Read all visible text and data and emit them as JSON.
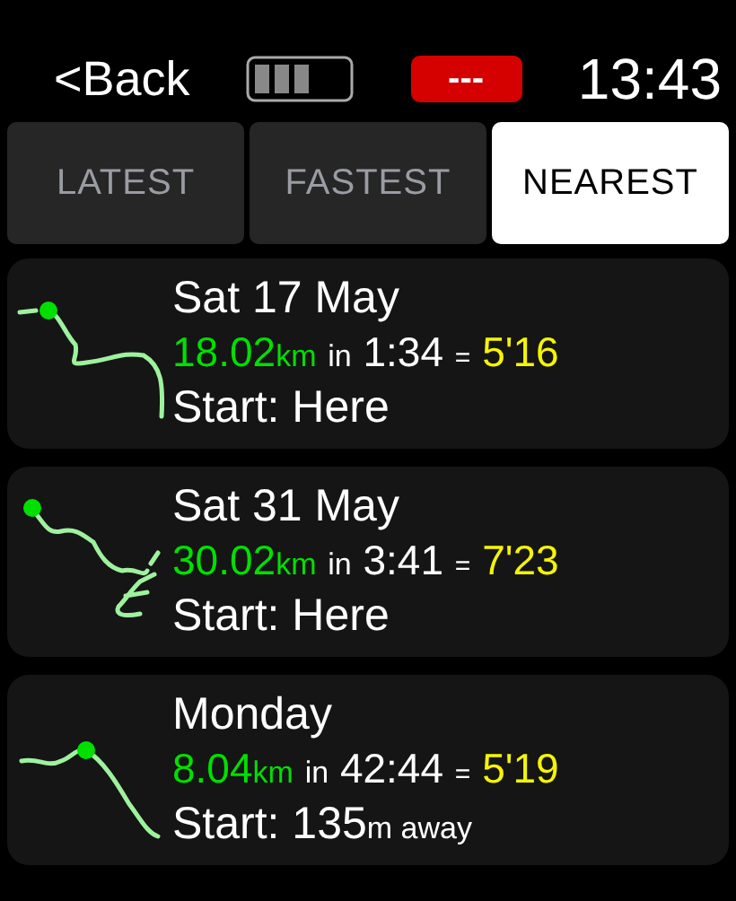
{
  "header": {
    "back": "<Back",
    "badge": "---",
    "time": "13:43"
  },
  "tabs": [
    {
      "label": "LATEST",
      "selected": false
    },
    {
      "label": "FASTEST",
      "selected": false
    },
    {
      "label": "NEAREST",
      "selected": true
    }
  ],
  "runs": [
    {
      "title": "Sat 17 May",
      "distance": "18.02",
      "distance_unit": "km",
      "in": "in",
      "time": "1:34",
      "equals": "=",
      "pace": "5'16",
      "start": "Start: Here"
    },
    {
      "title": "Sat 31 May",
      "distance": "30.02",
      "distance_unit": "km",
      "in": "in",
      "time": "3:41",
      "equals": "=",
      "pace": "7'23",
      "start": "Start: Here"
    },
    {
      "title": "Monday",
      "distance": "8.04",
      "distance_unit": "km",
      "in": "in",
      "time": "42:44",
      "equals": "=",
      "pace": "5'19",
      "start": "Start: 135",
      "start_unit": "m away"
    }
  ]
}
